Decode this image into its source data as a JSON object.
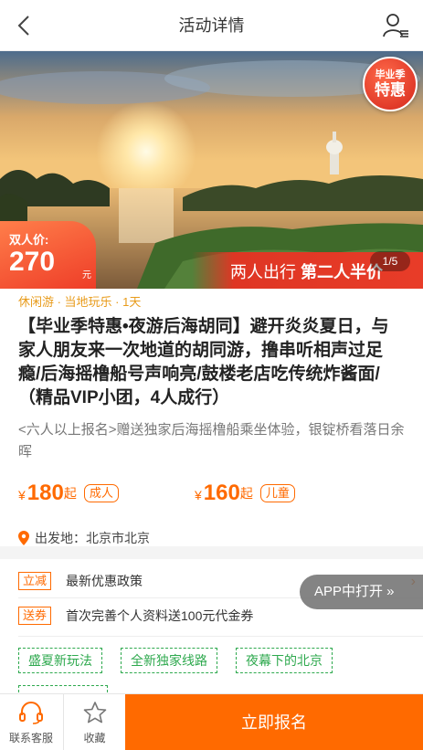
{
  "header": {
    "title": "活动详情",
    "back_icon": "chevron-left-icon",
    "user_icon": "user-menu-icon"
  },
  "hero": {
    "badge_line1": "毕业季",
    "badge_line2": "特惠",
    "price_label": "双人价:",
    "price_value": "270",
    "price_unit": "元",
    "strip_text_a": "两人出行 ",
    "strip_text_b": "第二人半价",
    "pager": "1/5"
  },
  "info": {
    "category": "休闲游 · 当地玩乐 · 1天",
    "title": "【毕业季特惠•夜游后海胡同】避开炎炎夏日，与家人朋友来一次地道的胡同游，撸串听相声过足瘾/后海摇橹船号声响亮/鼓楼老店吃传统炸酱面/（精品VIP小团，4人成行）",
    "subtitle": "<六人以上报名>赠送独家后海摇橹船乘坐体验，银锭桥看落日余晖",
    "prices": [
      {
        "yen": "¥",
        "value": "180",
        "qi": "起",
        "tag": "成人"
      },
      {
        "yen": "¥",
        "value": "160",
        "qi": "起",
        "tag": "儿童"
      }
    ],
    "depart_label": "出发地：北京市北京"
  },
  "offers": {
    "items": [
      {
        "tag": "立减",
        "text": "最新优惠政策"
      },
      {
        "tag": "送券",
        "text": "首次完善个人资料送100元代金券"
      }
    ],
    "app_open": "APP中打开 »",
    "theme_tags": [
      "盛夏新玩法",
      "全新独家线路",
      "夜幕下的北京"
    ]
  },
  "bottom": {
    "service": "联系客服",
    "favorite": "收藏",
    "signup": "立即报名"
  },
  "colors": {
    "accent": "#ff6a00",
    "green": "#2ea94e",
    "category": "#e89b1a"
  }
}
